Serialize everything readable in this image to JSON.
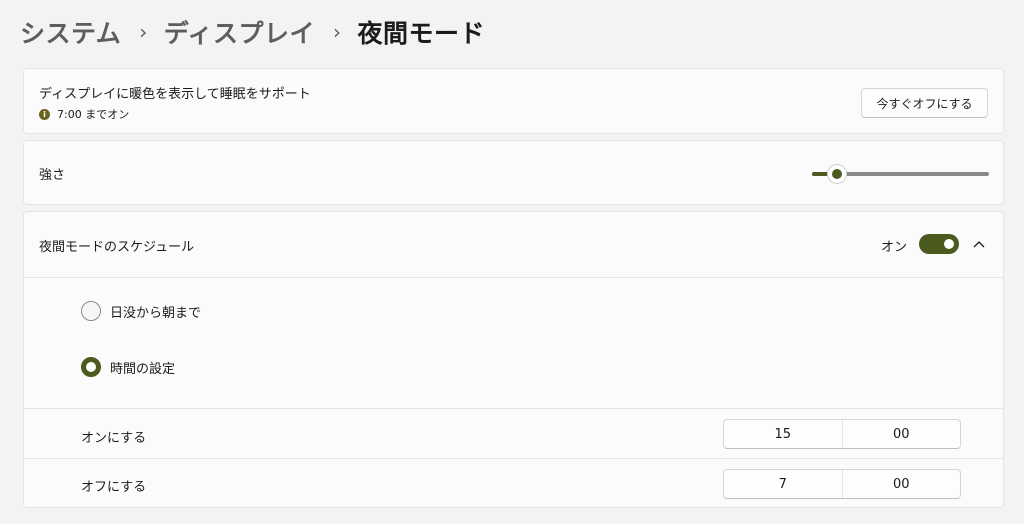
{
  "breadcrumb": {
    "items": [
      "システム",
      "ディスプレイ",
      "夜間モード"
    ],
    "separator": "›"
  },
  "info_card": {
    "title": "ディスプレイに暖色を表示して睡眠をサポート",
    "status": "7:00 までオン",
    "status_icon": "info-icon",
    "button_label": "今すぐオフにする"
  },
  "strength": {
    "label": "強さ",
    "value_percent": 14
  },
  "schedule": {
    "label": "夜間モードのスケジュール",
    "toggle_label": "オン",
    "toggle_on": true,
    "expanded": true,
    "options": [
      {
        "label": "日没から朝まで",
        "selected": false
      },
      {
        "label": "時間の設定",
        "selected": true
      }
    ],
    "turn_on": {
      "label": "オンにする",
      "hour": "15",
      "minute": "00"
    },
    "turn_off": {
      "label": "オフにする",
      "hour": "7",
      "minute": "00"
    }
  },
  "colors": {
    "accent": "#4b5a1f",
    "background": "#f3f3f3",
    "card": "#fbfbfb"
  }
}
